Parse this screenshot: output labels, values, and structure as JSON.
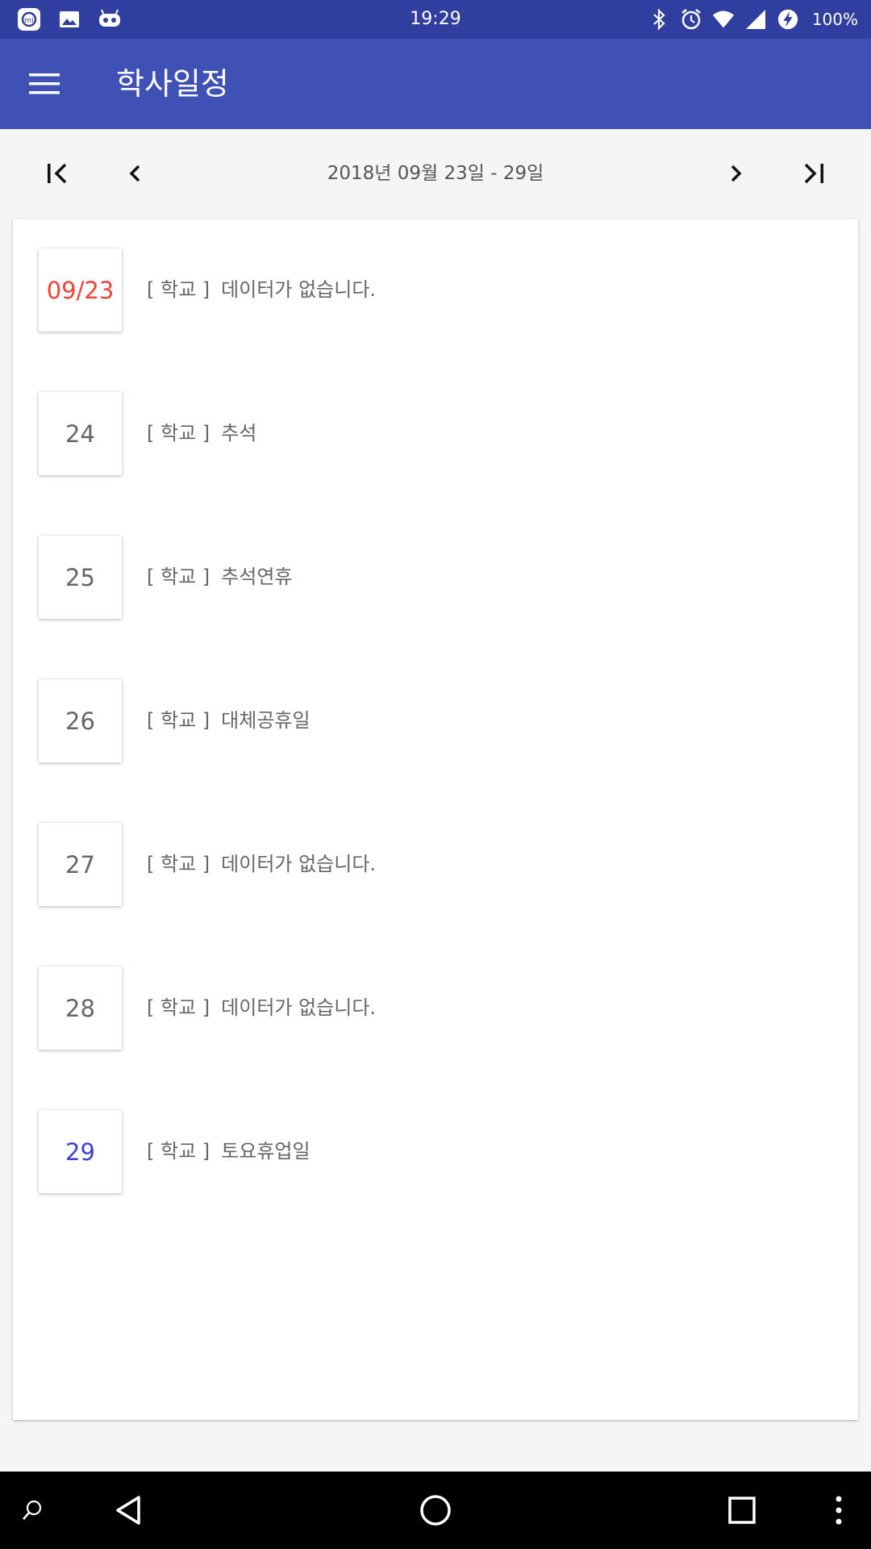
{
  "status_bar": {
    "time": "19:29",
    "battery": "100%",
    "left_icons": [
      "mi-app-icon",
      "gallery-icon",
      "game-icon"
    ],
    "right_icons": [
      "bluetooth-icon",
      "alarm-icon",
      "wifi-icon",
      "signal-icon",
      "battery-charging-icon"
    ]
  },
  "app_bar": {
    "title": "학사일정",
    "menu_icon": "hamburger-menu-icon",
    "color": "#3f51b5"
  },
  "week_nav": {
    "label": "2018년 09월 23일 - 29일",
    "first_icon": "first-page-icon",
    "prev_icon": "chevron-left-icon",
    "next_icon": "chevron-right-icon",
    "last_icon": "last-page-icon"
  },
  "schedule": [
    {
      "date": "09/23",
      "tag": "[ 학교 ]",
      "event": "데이터가 없습니다.",
      "color": "#f44336"
    },
    {
      "date": "24",
      "tag": "[ 학교 ]",
      "event": "추석",
      "color": "#666666"
    },
    {
      "date": "25",
      "tag": "[ 학교 ]",
      "event": "추석연휴",
      "color": "#666666"
    },
    {
      "date": "26",
      "tag": "[ 학교 ]",
      "event": "대체공휴일",
      "color": "#666666"
    },
    {
      "date": "27",
      "tag": "[ 학교 ]",
      "event": "데이터가 없습니다.",
      "color": "#666666"
    },
    {
      "date": "28",
      "tag": "[ 학교 ]",
      "event": "데이터가 없습니다.",
      "color": "#666666"
    },
    {
      "date": "29",
      "tag": "[ 학교 ]",
      "event": "토요휴업일",
      "color": "#3f3fd1"
    }
  ],
  "bottom_nav": {
    "icons": [
      "search-icon",
      "back-icon",
      "home-icon",
      "recents-icon",
      "more-vert-icon"
    ]
  }
}
